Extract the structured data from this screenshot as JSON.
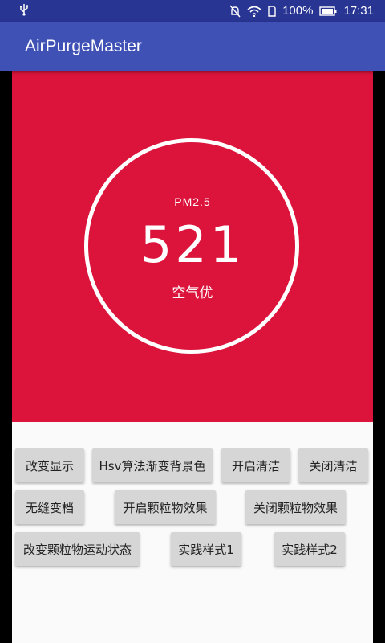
{
  "status_bar": {
    "battery_percent": "100%",
    "time": "17:31",
    "icons": [
      "usb-icon",
      "mute-icon",
      "wifi-icon",
      "sim-icon",
      "battery-icon"
    ]
  },
  "app_bar": {
    "title": "AirPurgeMaster"
  },
  "hero": {
    "background_color": "#dc143c",
    "pm_label": "PM2.5",
    "pm_value": "521",
    "quality_text": "空气优"
  },
  "buttons": {
    "change_display": "改变显示",
    "hsv_gradient": "Hsv算法渐变背景色",
    "start_clean": "开启清洁",
    "stop_clean": "关闭清洁",
    "seamless_shift": "无缝变档",
    "start_particles": "开启颗粒物效果",
    "stop_particles": "关闭颗粒物效果",
    "change_particle_state": "改变颗粒物运动状态",
    "style_1": "实践样式1",
    "style_2": "实践样式2"
  },
  "colors": {
    "status_bar": "#283593",
    "app_bar": "#3f51b5",
    "button": "#d6d6d6"
  }
}
